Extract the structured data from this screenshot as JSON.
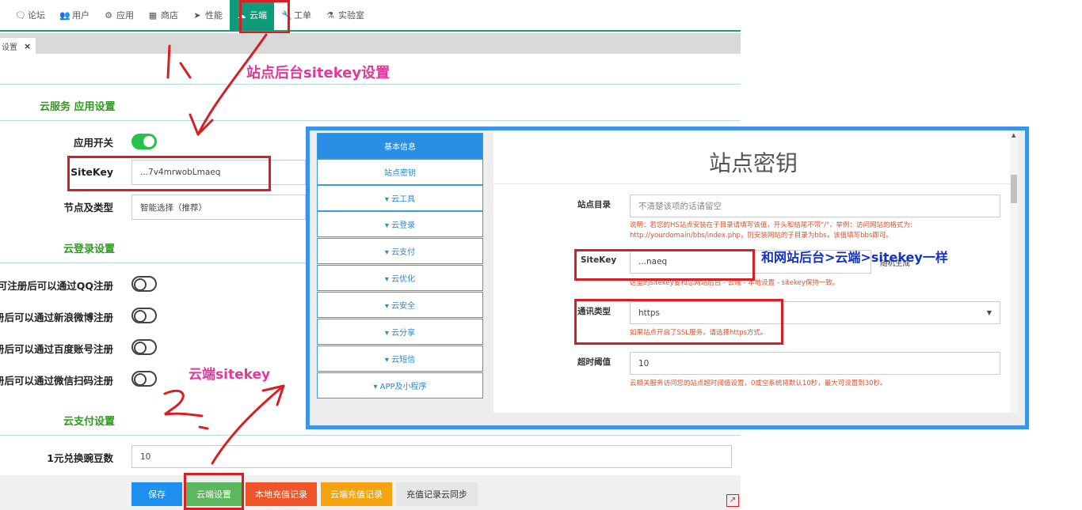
{
  "nav": {
    "items": [
      {
        "icon": "chat-icon",
        "label": "论坛"
      },
      {
        "icon": "users-icon",
        "label": "用户"
      },
      {
        "icon": "apps-icon",
        "label": "应用"
      },
      {
        "icon": "shop-icon",
        "label": "商店"
      },
      {
        "icon": "send-icon",
        "label": "性能"
      },
      {
        "icon": "cloud-icon",
        "label": "云端",
        "active": true
      },
      {
        "icon": "wrench-icon",
        "label": "工单"
      },
      {
        "icon": "flask-icon",
        "label": "实验室"
      }
    ]
  },
  "tab": {
    "label": "设置",
    "close": "×"
  },
  "annotations": {
    "header": "站点后台sitekey设置",
    "step1": "1、",
    "step2": "2、",
    "cloud_sitekey": "云端sitekey",
    "same_as": "和网站后台>云端>sitekey一样"
  },
  "form": {
    "section_app": "云服务 应用设置",
    "app_switch_label": "应用开关",
    "sitekey_label": "SiteKey",
    "sitekey_value": "...7v4mrwobLmaeq",
    "node_label": "节点及类型",
    "node_value": "智能选择（推荐）",
    "section_login": "云登录设置",
    "login_rows": [
      "可注册后可以通过QQ注册",
      "册后可以通过新浪微博注册",
      "册后可以通过百度账号注册",
      "册后可以通过微信扫码注册"
    ],
    "section_pay": "云支付设置",
    "exchange_label": "1元兑换豌豆数",
    "exchange_value": "10"
  },
  "buttons": {
    "save": "保存",
    "cloud_settings": "云端设置",
    "local_recharge": "本地充值记录",
    "cloud_recharge": "云端充值记录",
    "sync": "充值记录云同步"
  },
  "colors": {
    "nav_active": "#0d9b79",
    "save": "#1e90f0",
    "cloud_settings": "#5cb85c",
    "local_recharge": "#f0552a",
    "cloud_recharge": "#f5a30e",
    "sync": "#e6e6e6",
    "annotation_red": "#d81f26",
    "overlay_border": "#3b94ea"
  },
  "overlay": {
    "sidebar": [
      "基本信息",
      "站点密钥",
      "▾ 云工具",
      "▾ 云登录",
      "▾ 云支付",
      "▾ 云优化",
      "▾ 云安全",
      "▾ 云分享",
      "▾ 云短信",
      "▾ APP及小程序"
    ],
    "title": "站点密钥",
    "site_dir_label": "站点目录",
    "site_dir_placeholder": "不清楚该项的话请留空",
    "site_dir_hint1": "说明：若您的HS站点安装在子目录请填写该值，开头和结尾不带\"/\"，举例：访问网站的格式为:",
    "site_dir_hint2": "http://yourdomain/bbs/index.php，则安装网站的子目录为bbs，该值填写bbs即可。",
    "sitekey_label": "SiteKey",
    "sitekey_value": "...naeq",
    "random_label": "随机生成",
    "sitekey_hint": "这里的sitekey要和您网站后台 - 云端 - 本地设置 - sitekey保持一致。",
    "comm_label": "通讯类型",
    "comm_value": "https",
    "comm_hint": "如果站点开启了SSL服务，请选择https方式。",
    "timeout_label": "超时阈值",
    "timeout_value": "10",
    "timeout_hint": "云相关服务访问您的站点超时阈值设置，0或空系统将默认10秒，最大可设置到30秒。"
  }
}
